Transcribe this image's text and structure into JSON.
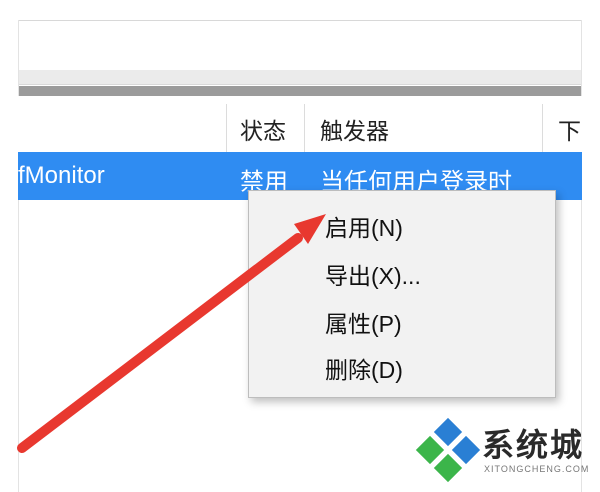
{
  "table": {
    "columns": [
      {
        "label": "状态"
      },
      {
        "label": "触发器"
      },
      {
        "label": "下"
      }
    ],
    "row": {
      "name": "fMonitor",
      "status": "禁用",
      "trigger": "当任何用户登录时"
    }
  },
  "context_menu": {
    "items": [
      {
        "label": "启用(N)"
      },
      {
        "label": "导出(X)..."
      },
      {
        "label": "属性(P)"
      },
      {
        "label": "删除(D)"
      }
    ]
  },
  "watermark": {
    "brand": "系统城",
    "domain": "XITONGCHENG.COM"
  },
  "colors": {
    "selection": "#2f8cf2",
    "arrow": "#e8382f",
    "menu_bg": "#f2f2f2",
    "wm_blue": "#2a7fd4",
    "wm_green": "#3bb54a"
  }
}
